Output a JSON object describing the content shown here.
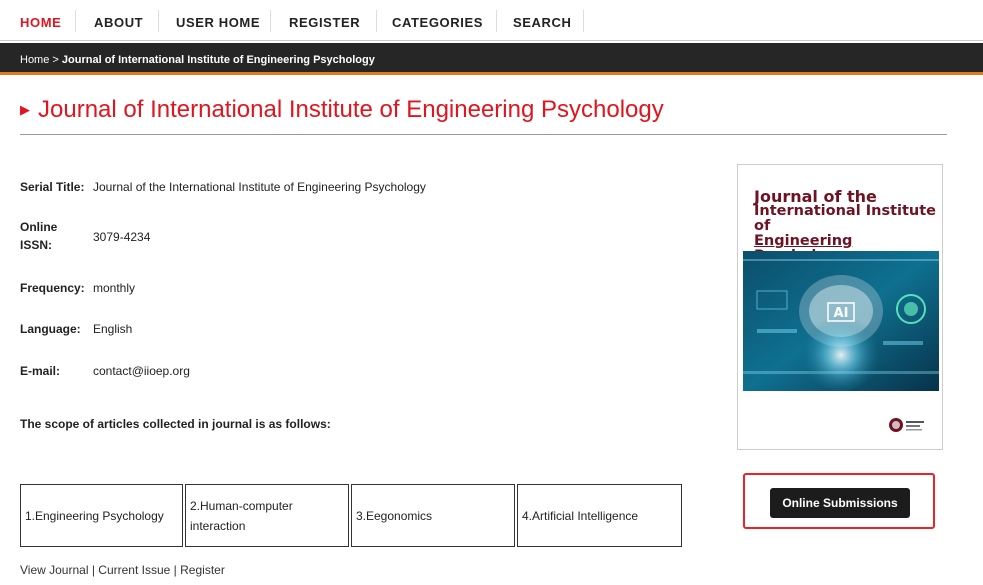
{
  "nav": [
    {
      "label": "HOME",
      "active": true
    },
    {
      "label": "ABOUT"
    },
    {
      "label": "USER HOME"
    },
    {
      "label": "REGISTER"
    },
    {
      "label": "CATEGORIES"
    },
    {
      "label": "SEARCH"
    }
  ],
  "breadcrumb": {
    "home": "Home",
    "separator": ">",
    "current": "Journal of International Institute of Engineering Psychology"
  },
  "page_title": "Journal of International Institute of Engineering Psychology",
  "fields": {
    "serial_title": {
      "label": "Serial Title:",
      "value": "Journal of the International Institute of Engineering Psychology"
    },
    "issn": {
      "label_line1": "Online",
      "label_line2": "ISSN:",
      "value": "3079-4234"
    },
    "frequency": {
      "label": "Frequency:",
      "value": "monthly"
    },
    "language": {
      "label": "Language:",
      "value": "English"
    },
    "email": {
      "label": "E-mail:",
      "value": "contact@iioep.org"
    }
  },
  "scope_heading": "The scope of articles collected in journal is as follows:",
  "scope_items": [
    "1.Engineering Psychology",
    "2.Human-computer interaction",
    "3.Eegonomics",
    "4.Artificial Intelligence"
  ],
  "footer_links": {
    "view_journal": "View Journal",
    "current_issue": "Current Issue",
    "register": "Register",
    "separator": "|"
  },
  "cover": {
    "title_line1": "Journal of the",
    "title_line2": "International Institute of",
    "title_line3": "Engineering Psychology",
    "ai_label": "AI"
  },
  "submit_label": "Online Submissions",
  "colors": {
    "accent_red": "#e0151d",
    "crumb_bar": "#262626",
    "crumb_underline": "#e07a1e",
    "cover_title": "#6d1322",
    "button_bg": "#1c1c1c"
  }
}
